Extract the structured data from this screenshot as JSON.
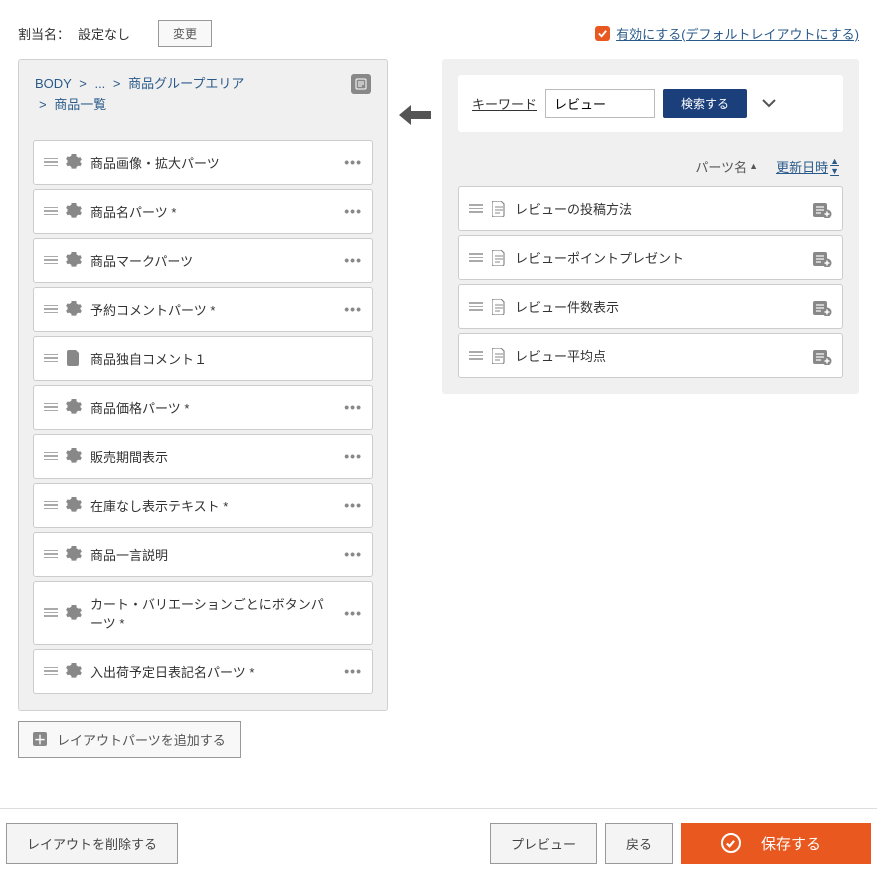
{
  "top": {
    "assign_label": "割当名：",
    "assign_value": "設定なし",
    "change_btn": "変更",
    "enable_label": "有効にする(デフォルトレイアウトにする)"
  },
  "breadcrumb": {
    "root": "BODY",
    "ellipsis": "...",
    "group": "商品グループエリア",
    "current": "商品一覧",
    "sep": ">"
  },
  "parts": [
    {
      "label": "商品画像・拡大パーツ",
      "icon": "gear"
    },
    {
      "label": "商品名パーツ *",
      "icon": "gear"
    },
    {
      "label": "商品マークパーツ",
      "icon": "gear"
    },
    {
      "label": "予約コメントパーツ *",
      "icon": "gear"
    },
    {
      "label": "商品独自コメント１",
      "icon": "file"
    },
    {
      "label": "商品価格パーツ *",
      "icon": "gear"
    },
    {
      "label": "販売期間表示",
      "icon": "gear"
    },
    {
      "label": "在庫なし表示テキスト *",
      "icon": "gear"
    },
    {
      "label": "商品一言説明",
      "icon": "gear"
    },
    {
      "label": "カート・バリエーションごとにボタンパーツ *",
      "icon": "gear"
    },
    {
      "label": "入出荷予定日表記名パーツ *",
      "icon": "gear"
    }
  ],
  "add_button": "レイアウトパーツを追加する",
  "search": {
    "kw_label": "キーワード",
    "kw_value": "レビュー",
    "btn_label": "検索する"
  },
  "sort": {
    "name_label": "パーツ名",
    "date_label": "更新日時"
  },
  "results": [
    {
      "label": "レビューの投稿方法"
    },
    {
      "label": "レビューポイントプレゼント"
    },
    {
      "label": "レビュー件数表示"
    },
    {
      "label": "レビュー平均点"
    }
  ],
  "footer": {
    "delete_btn": "レイアウトを削除する",
    "preview_btn": "プレビュー",
    "back_btn": "戻る",
    "save_btn": "保存する"
  }
}
